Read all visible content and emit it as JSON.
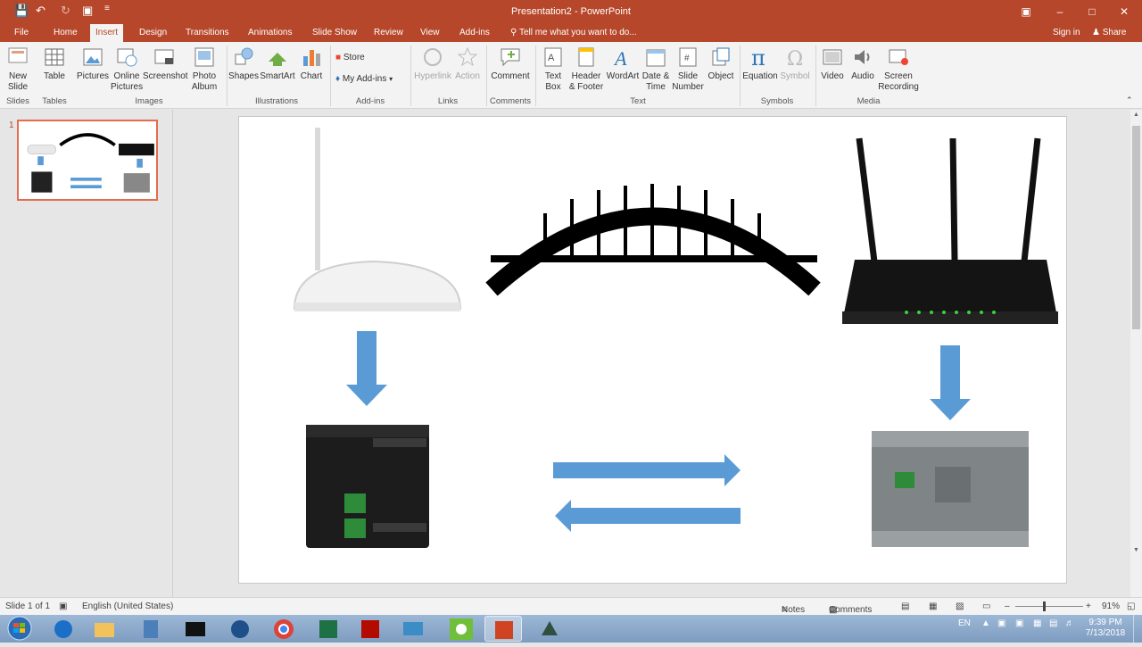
{
  "window": {
    "title": "Presentation2 - PowerPoint",
    "sign_in": "Sign in",
    "share": "Share",
    "tell_me": "Tell me what you want to do..."
  },
  "tabs": [
    "File",
    "Home",
    "Insert",
    "Design",
    "Transitions",
    "Animations",
    "Slide Show",
    "Review",
    "View",
    "Add-ins"
  ],
  "ribbon": {
    "new_slide": [
      "New",
      "Slide"
    ],
    "table": "Table",
    "pictures": "Pictures",
    "online_pictures": [
      "Online",
      "Pictures"
    ],
    "screenshot": "Screenshot",
    "photo_album": [
      "Photo",
      "Album"
    ],
    "shapes": "Shapes",
    "smartart": "SmartArt",
    "chart": "Chart",
    "store": "Store",
    "my_addins": "My Add-ins",
    "hyperlink": "Hyperlink",
    "action": "Action",
    "comment": "Comment",
    "text_box": [
      "Text",
      "Box"
    ],
    "header_footer": [
      "Header",
      "& Footer"
    ],
    "wordart": "WordArt",
    "date_time": [
      "Date &",
      "Time"
    ],
    "slide_number": [
      "Slide",
      "Number"
    ],
    "object": "Object",
    "equation": "Equation",
    "symbol": "Symbol",
    "video": "Video",
    "audio": "Audio",
    "screen_recording": [
      "Screen",
      "Recording"
    ],
    "groups": {
      "slides": "Slides",
      "tables": "Tables",
      "images": "Images",
      "illustrations": "Illustrations",
      "addins": "Add-ins",
      "links": "Links",
      "comments": "Comments",
      "text": "Text",
      "symbols": "Symbols",
      "media": "Media"
    }
  },
  "thumbnail": {
    "number": "1"
  },
  "status": {
    "slide": "Slide 1 of 1",
    "language": "English (United States)",
    "notes": "Notes",
    "comments": "Comments",
    "zoom": "91%"
  },
  "tray": {
    "lang": "EN",
    "time": "9:39 PM",
    "date": "7/13/2018"
  },
  "colors": {
    "accent": "#b7472a",
    "arrow": "#5b9bd5"
  }
}
